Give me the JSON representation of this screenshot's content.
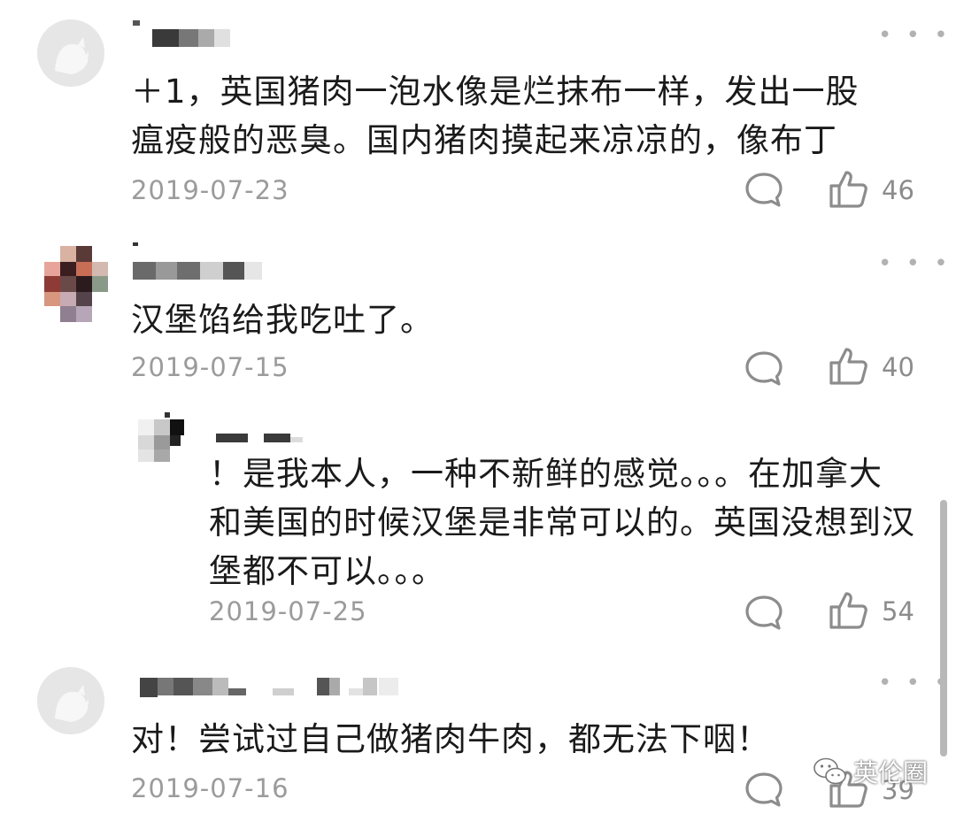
{
  "comments": [
    {
      "text_lines": [
        "＋1，英国猪肉一泡水像是烂抹布一样，发出一股",
        "瘟疫般的恶臭。国内猪肉摸起来凉凉的，像布丁"
      ],
      "date": "2019-07-23",
      "likes": "46"
    },
    {
      "text_lines": [
        "汉堡馅给我吃吐了。"
      ],
      "date": "2019-07-15",
      "likes": "40",
      "replies": [
        {
          "text_lines": [
            "！是我本人，一种不新鲜的感觉。。。在加拿大",
            "和美国的时候汉堡是非常可以的。英国没想到汉",
            "堡都不可以。。。"
          ],
          "date": "2019-07-25",
          "likes": "54"
        }
      ]
    },
    {
      "text_lines": [
        "对！尝试过自己做猪肉牛肉，都无法下咽！"
      ],
      "date": "2019-07-16",
      "likes": "39"
    }
  ],
  "more_glyph": "• • •",
  "watermark": {
    "label": "英伦圈",
    "icon": "wechat-icon"
  },
  "colors": {
    "text": "#1a1a1a",
    "date": "#9b9b9b",
    "icon": "#8c8c8c"
  }
}
